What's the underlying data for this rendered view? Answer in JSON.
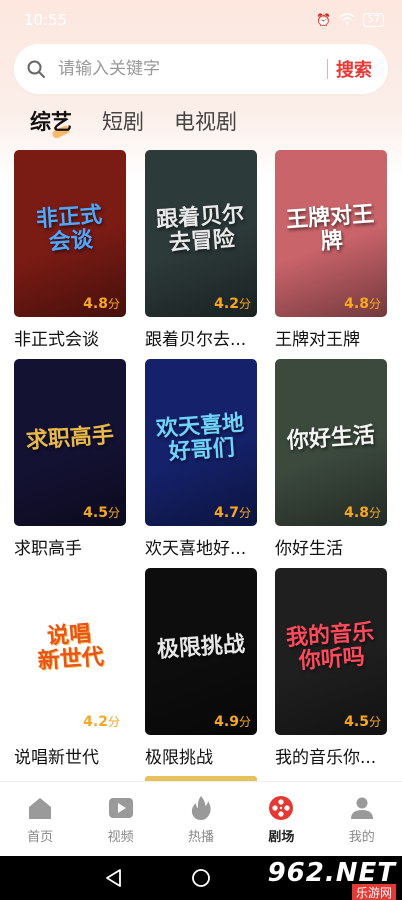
{
  "status": {
    "time": "10:55",
    "battery": "57"
  },
  "search": {
    "placeholder": "请输入关键字",
    "button_label": "搜索"
  },
  "tabs": [
    {
      "label": "综艺",
      "active": true
    },
    {
      "label": "短剧",
      "active": false
    },
    {
      "label": "电视剧",
      "active": false
    }
  ],
  "shows": [
    {
      "title": "非正式会谈",
      "rating": "4.8",
      "unit": "分",
      "art": "非正式\n会谈",
      "bg": "#7a1b14",
      "art_color": "#4fa8ff"
    },
    {
      "title": "跟着贝尔去...",
      "rating": "4.2",
      "unit": "分",
      "art": "跟着贝尔\n去冒险",
      "bg": "#2d3a3a",
      "art_color": "#e8e8e8"
    },
    {
      "title": "王牌对王牌",
      "rating": "4.8",
      "unit": "分",
      "art": "王牌对王牌",
      "bg": "#c9646a",
      "art_color": "#ffffff"
    },
    {
      "title": "求职高手",
      "rating": "4.5",
      "unit": "分",
      "art": "求职高手",
      "bg": "#141233",
      "art_color": "#e9b84c"
    },
    {
      "title": "欢天喜地好...",
      "rating": "4.7",
      "unit": "分",
      "art": "欢天喜地\n好哥们",
      "bg": "#15226b",
      "art_color": "#6fd3ff"
    },
    {
      "title": "你好生活",
      "rating": "4.8",
      "unit": "分",
      "art": "你好生活",
      "bg": "#3c4a3e",
      "art_color": "#f5f5f5"
    },
    {
      "title": "说唱新世代",
      "rating": "4.2",
      "unit": "分",
      "art": "说唱\n新世代",
      "bg": "#ffffff",
      "art_color": "#e8541c"
    },
    {
      "title": "极限挑战",
      "rating": "4.9",
      "unit": "分",
      "art": "极限挑战",
      "bg": "#0d0d0d",
      "art_color": "#e8e8e8"
    },
    {
      "title": "我的音乐你...",
      "rating": "4.5",
      "unit": "分",
      "art": "我的音乐\n你听吗",
      "bg": "#1f1f1f",
      "art_color": "#ff4a5c"
    }
  ],
  "bottom_nav": [
    {
      "label": "首页",
      "icon": "home-icon",
      "active": false
    },
    {
      "label": "视频",
      "icon": "video-play-icon",
      "active": false
    },
    {
      "label": "热播",
      "icon": "flame-icon",
      "active": false
    },
    {
      "label": "剧场",
      "icon": "film-reel-icon",
      "active": true
    },
    {
      "label": "我的",
      "icon": "user-icon",
      "active": false
    }
  ],
  "watermark": {
    "brand": "962.NET",
    "sub": "乐游网"
  },
  "colors": {
    "accent": "#e53935",
    "rating": "#f6a723"
  }
}
